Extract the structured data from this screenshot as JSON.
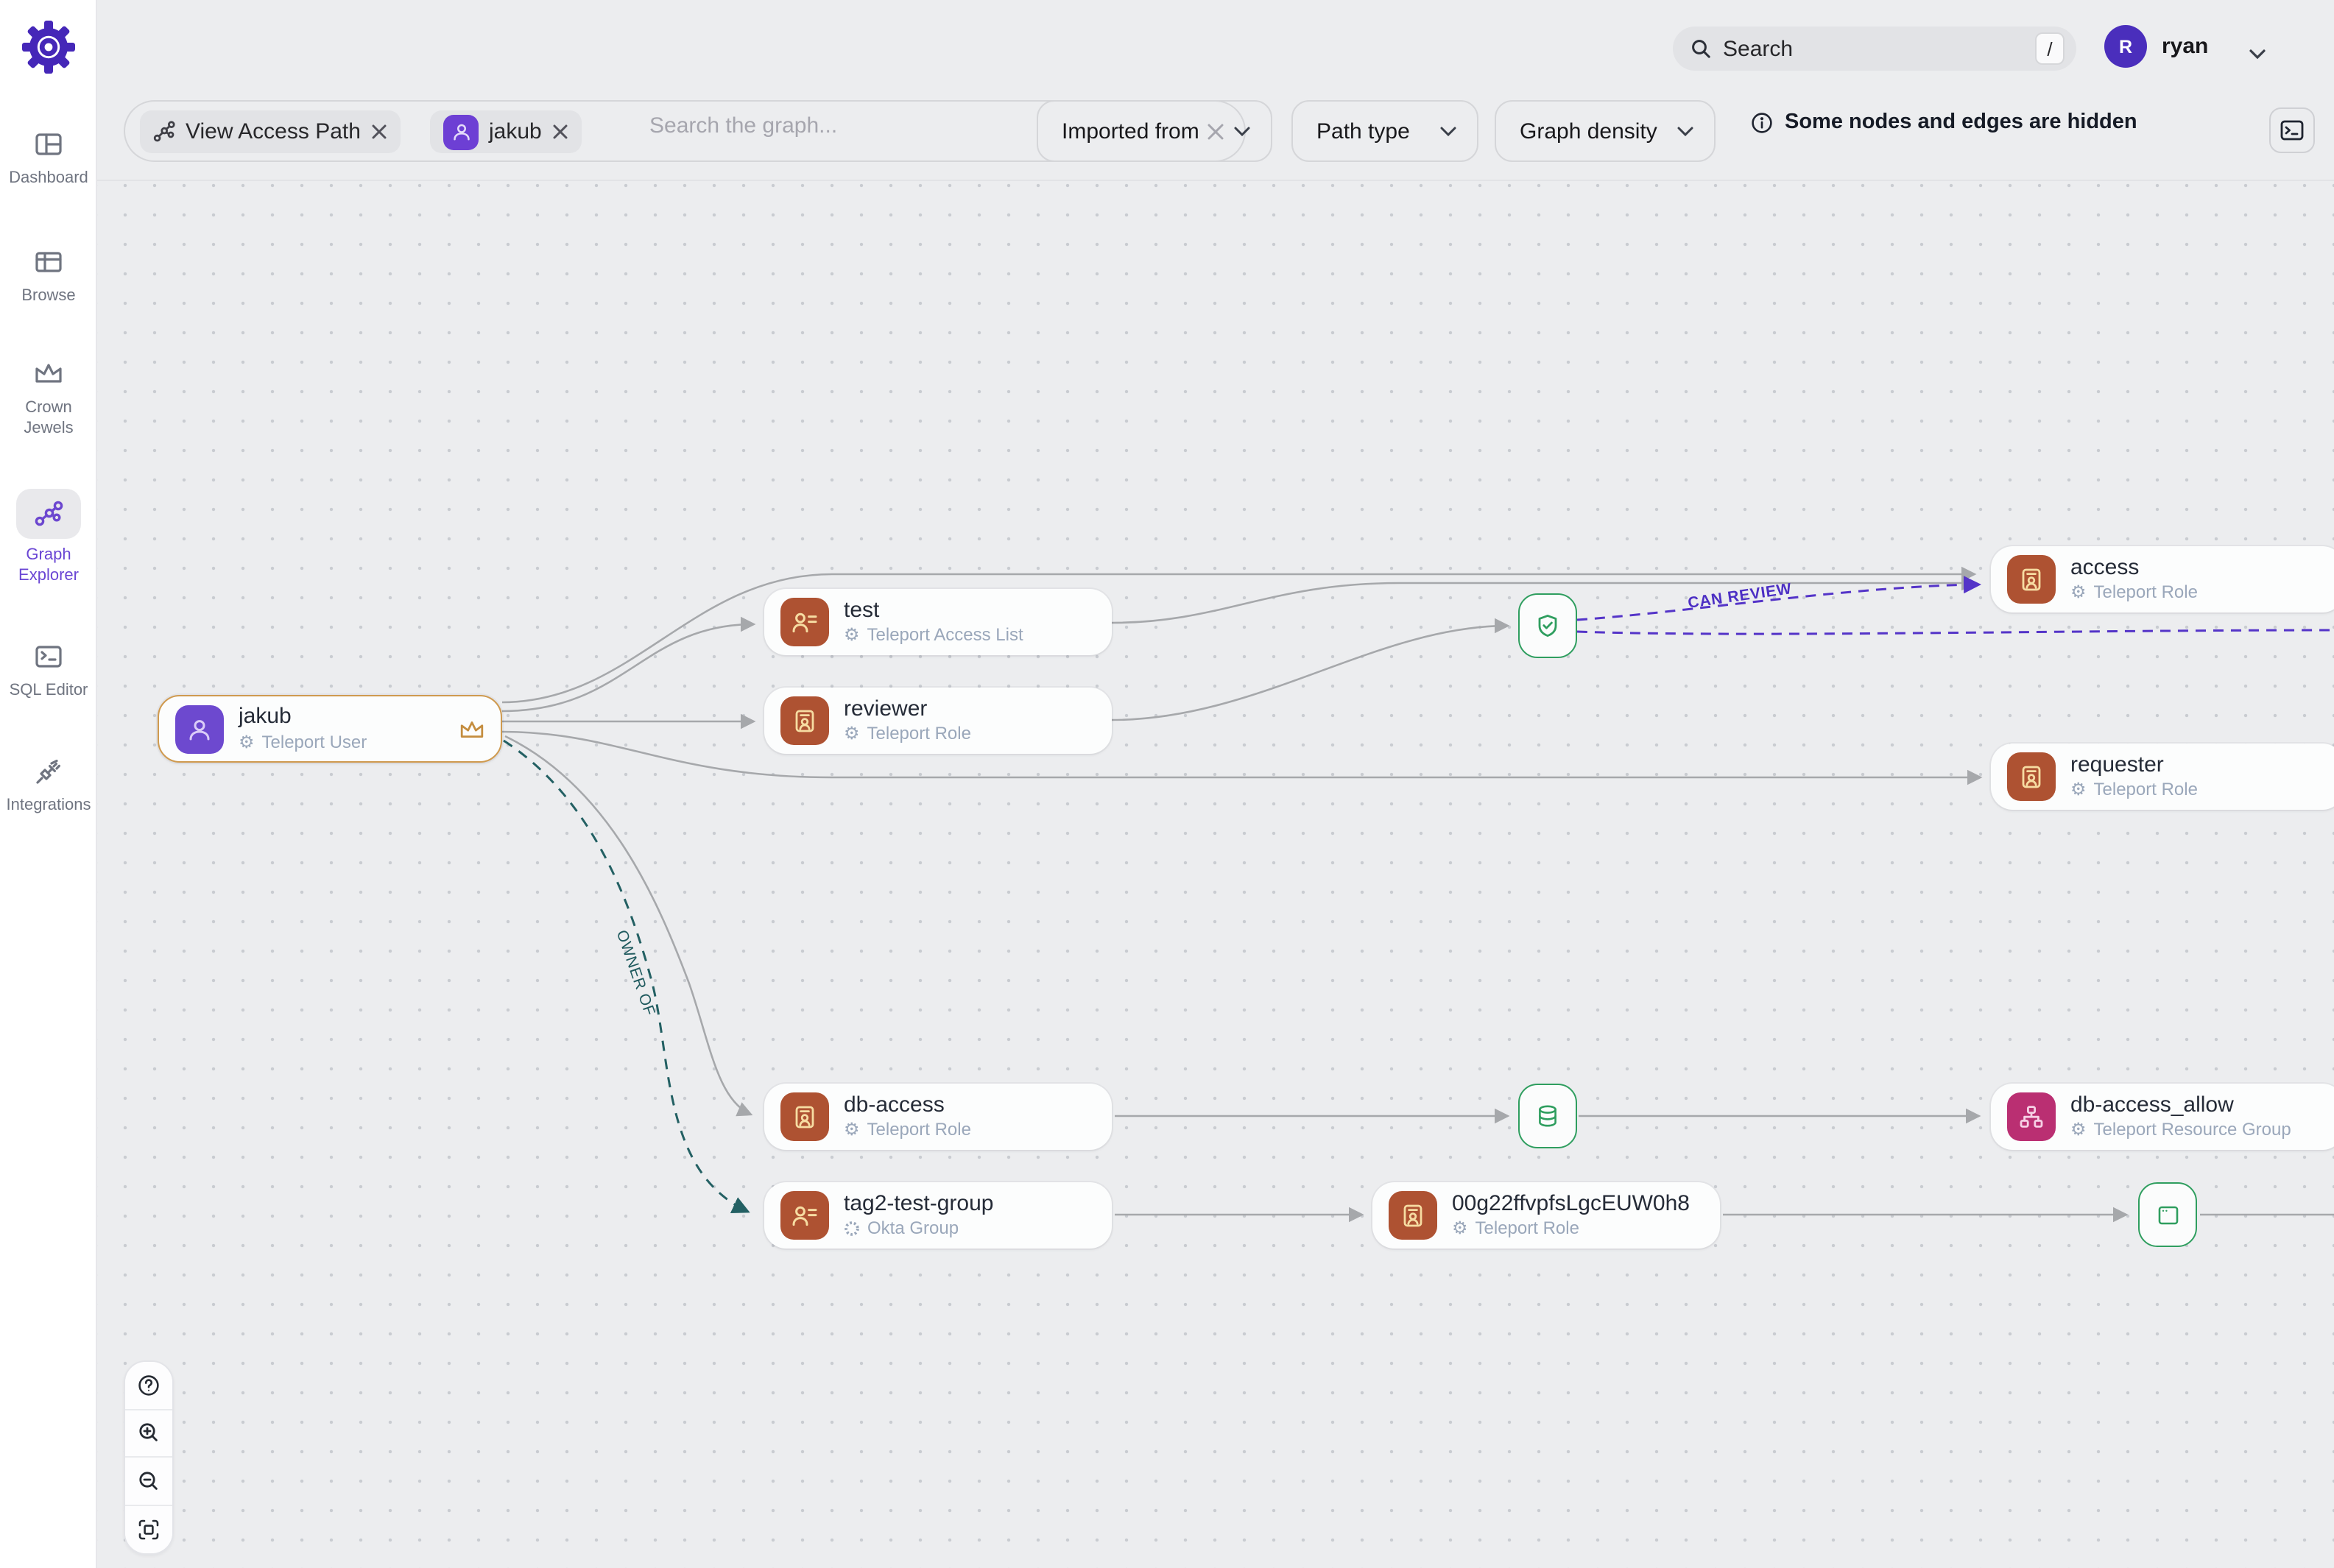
{
  "topbar": {
    "search_placeholder": "Search",
    "search_shortcut": "/",
    "user_initial": "R",
    "user_name": "ryan"
  },
  "sidebar": {
    "items": [
      {
        "label": "Dashboard"
      },
      {
        "label": "Browse"
      },
      {
        "label": "Crown Jewels"
      },
      {
        "label": "Graph Explorer"
      },
      {
        "label": "SQL Editor"
      },
      {
        "label": "Integrations"
      }
    ]
  },
  "filters": {
    "chips": [
      {
        "label": "View Access Path"
      },
      {
        "label": "jakub"
      }
    ],
    "search_placeholder": "Search the graph...",
    "dropdowns": [
      {
        "label": "Imported from"
      },
      {
        "label": "Path type"
      },
      {
        "label": "Graph density"
      }
    ],
    "notice": "Some nodes and edges are hidden"
  },
  "graph": {
    "nodes": [
      {
        "title": "jakub",
        "subtitle": "Teleport User"
      },
      {
        "title": "test",
        "subtitle": "Teleport Access List"
      },
      {
        "title": "reviewer",
        "subtitle": "Teleport Role"
      },
      {
        "title": "access",
        "subtitle": "Teleport Role"
      },
      {
        "title": "requester",
        "subtitle": "Teleport Role"
      },
      {
        "title": "db-access",
        "subtitle": "Teleport Role"
      },
      {
        "title": "tag2-test-group",
        "subtitle": "Okta Group"
      },
      {
        "title": "db-access_allow",
        "subtitle": "Teleport Resource Group"
      },
      {
        "title": "00g22ffvpfsLgcEUW0h8",
        "subtitle": "Teleport Role"
      }
    ],
    "edge_labels": {
      "can_review": "CAN REVIEW",
      "owner_of": "OWNER OF"
    }
  },
  "icons": {
    "gear_glyph": "⚙"
  },
  "colors": {
    "accent_rust": "#ae5232",
    "accent_purple": "#6d49cf",
    "accent_magenta": "#ba2f72",
    "green": "#2f9e5f",
    "highlight_orange": "#cf9a4f",
    "edge_gray": "#a6a8ab",
    "edge_purple": "#5434c8",
    "edge_teal": "#236063",
    "brand_purple": "#4527b8"
  }
}
